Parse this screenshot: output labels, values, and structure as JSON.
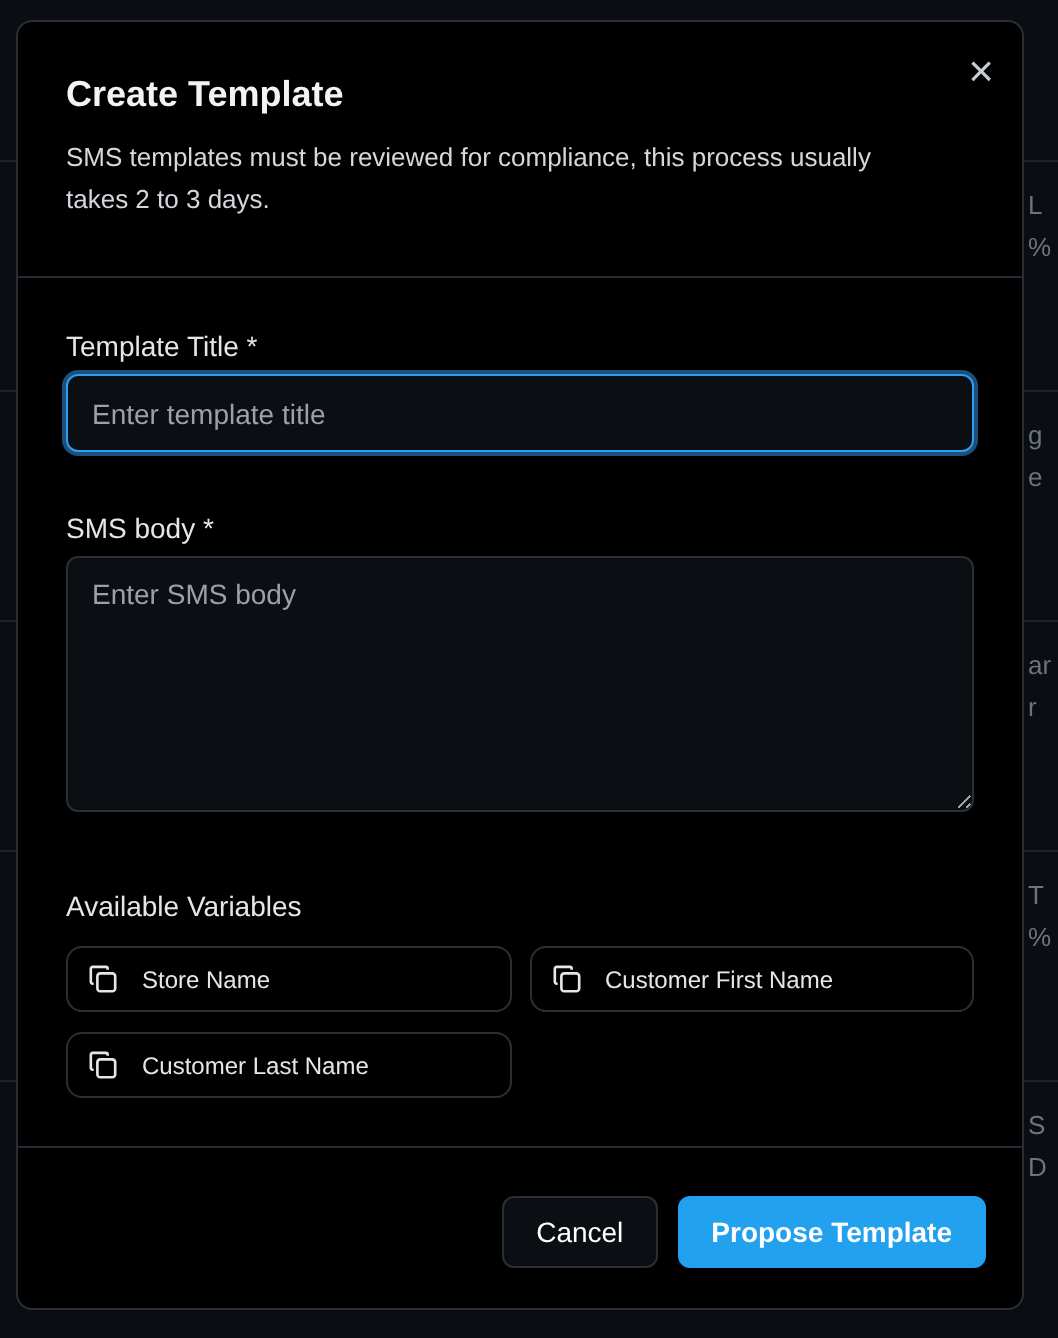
{
  "background": {
    "rows": [
      {
        "left": "",
        "right": [
          "L",
          "%"
        ]
      },
      {
        "left": "",
        "right": [
          "g",
          "e"
        ]
      },
      {
        "left": "",
        "right": [
          "ar",
          "r"
        ]
      },
      {
        "left": "",
        "right": [
          "T",
          "%"
        ]
      },
      {
        "left": "",
        "right": [
          "S",
          "D"
        ]
      }
    ]
  },
  "dialog": {
    "title": "Create Template",
    "close": "×",
    "description": "SMS templates must be reviewed for compliance, this process usually takes 2 to 3 days.",
    "fields": [
      {
        "kind": "input",
        "label": "Template Title *",
        "placeholder": "Enter template title",
        "focused": true
      },
      {
        "kind": "textarea",
        "label": "SMS body *",
        "placeholder": "Enter SMS body",
        "focused": false
      }
    ],
    "variables_label": "Available Variables",
    "variables": [
      "Store Name",
      "Customer First Name",
      "Customer Last Name"
    ],
    "buttons": [
      {
        "kind": "secondary",
        "label": "Cancel"
      },
      {
        "kind": "primary",
        "label": "Propose Template"
      }
    ]
  }
}
